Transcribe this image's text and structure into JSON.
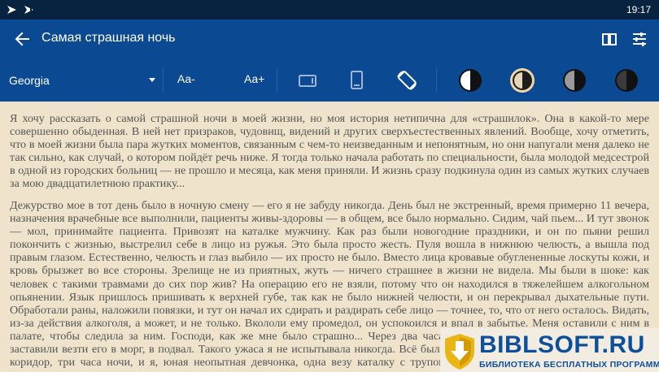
{
  "status_bar": {
    "time": "19:17"
  },
  "app_bar": {
    "title": "Самая страшная ночь"
  },
  "toolbar": {
    "font_name": "Georgia",
    "font_decrease_label": "Aa-",
    "font_increase_label": "Aa+"
  },
  "content": {
    "paragraph_1": "Я хочу рассказать о самой страшной ночи в моей жизни, но моя история нетипична для «страшилок». Она в какой-то мере совершенно обыденная. В ней нет призраков, чудовищ, видений и других сверхъестественных явлений. Вообще, хочу отметить, что в моей жизни была пара жутких моментов, связанным с чем-то неизведанным и непонятным, но они напугали меня далеко не так сильно, как случай, о котором пойдёт речь ниже. Я тогда только начала работать по специальности, была молодой медсестрой в одной из городских больниц — не прошло и месяца, как меня приняли. И жизнь сразу подкинула один из самых жутких случаев за мою двадцатилетнюю практику...",
    "paragraph_2": "Дежурство мое в тот день было в ночную смену — его я не забуду никогда. День был не экстренный, время примерно 11 вечера, назначения врачебные все выполнили, пациенты живы-здоровы — в общем, все было нормально. Сидим, чай пьем... И тут звонок — мол, принимайте пациента. Привозят на каталке мужчину. Как раз были новогодние праздники, и он по пьяни решил покончить с жизнью, выстрелил себе в лицо из ружья. Это была просто жесть. Пуля вошла в нижнюю челюсть, а вышла под правым глазом. Естественно, челюсть и глаз выбило — их просто не было. Вместо лица кровавые обуглененные лоскуты кожи, и кровь брызжет во все стороны. Зрелище не из приятных, жуть — ничего страшнее в жизни не видела. Мы были в шоке: как человек с такими травмами до сих пор жив? На операцию его не взяли, потому что он находился в тяжелейшем алкогольном опьянении. Язык пришлось пришивать к верхней губе, так как не было нижней челюсти, и он перекрывал дыхательные пути. Обработали раны, наложили повязки, и тут он начал их сдирать и раздирать себе лицо — точнее, то, что от него осталось. Видать, из-за действия алкоголя, а может, и не только. Вкололи ему промедол, он успокоился и впал в забытье. Меня оставили с ним в палате, чтобы следила за ним. Господи, как же мне было страшно... Через два часа он умер, и меня, как самую младшую, заставили везти его в морг, в подвал. Такого ужаса я не испытывала никогда. Всё было как во сне: длинный темный и мрачный коридор, три часа ночи, и я, юная неопытная девчонка, одна везу каталку с трупом, и только скрип колёс скрип нарушает тишину..."
  },
  "watermark": {
    "brand": "BIBLSOFT.RU",
    "tagline": "БИБЛИОТЕКА БЕСПЛАТНЫХ ПРОГРАММ"
  },
  "colors": {
    "status_bar": "#07233f",
    "app_bar": "#0b4a92",
    "reading_background": "#efe3cc",
    "text": "#555555",
    "brand": "#0e4f9c",
    "theme_selected_ring": "#f2d7a6"
  }
}
